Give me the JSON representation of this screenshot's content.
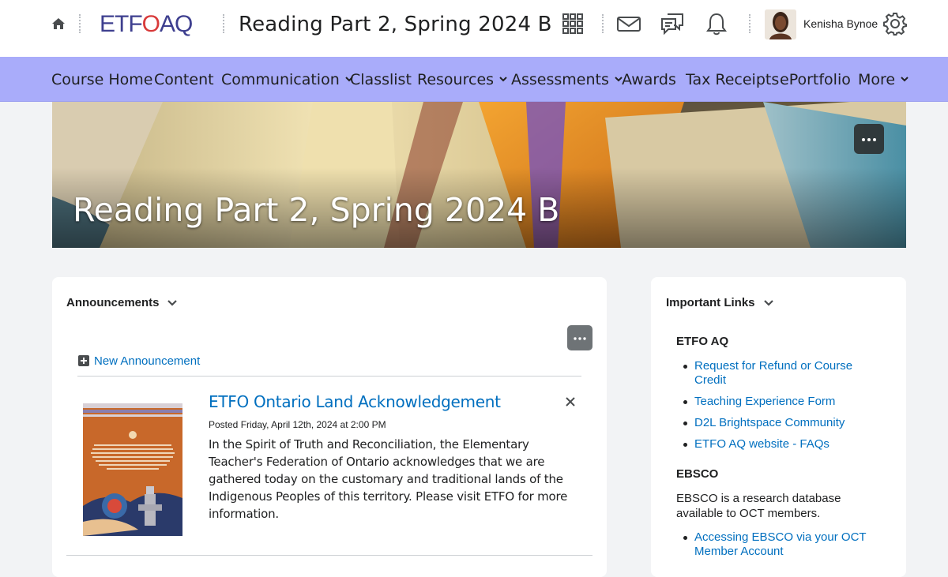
{
  "header": {
    "logo_text_left": "ETF",
    "logo_text_mid": "O",
    "logo_text_right": "AQ",
    "course_title": "Reading Part 2, Spring 2024 B",
    "user_name": "Kenisha Bynoe"
  },
  "nav": {
    "items": [
      {
        "label": "Course Home",
        "dropdown": false
      },
      {
        "label": "Content",
        "dropdown": false
      },
      {
        "label": "Communication",
        "dropdown": true
      },
      {
        "label": "Classlist",
        "dropdown": false
      },
      {
        "label": "Resources",
        "dropdown": true
      },
      {
        "label": "Assessments",
        "dropdown": true
      },
      {
        "label": "Awards",
        "dropdown": false
      },
      {
        "label": "Tax Receipts",
        "dropdown": false
      },
      {
        "label": "ePortfolio",
        "dropdown": false
      },
      {
        "label": "More",
        "dropdown": true
      }
    ]
  },
  "banner": {
    "title": "Reading Part 2, Spring 2024 B"
  },
  "announcements": {
    "title": "Announcements",
    "new_label": "New Announcement",
    "item": {
      "title": "ETFO Ontario Land Acknowledgement",
      "posted": "Posted Friday, April 12th, 2024 at 2:00 PM",
      "body": "In the Spirit of Truth and Reconciliation, the Elementary Teacher's Federation of Ontario acknowledges that we are gathered today on the customary and traditional lands of the Indigenous Peoples of this territory. Please visit ETFO for more information."
    }
  },
  "important_links": {
    "title": "Important Links",
    "etfo_heading": "ETFO AQ",
    "etfo_links": [
      "Request for Refund or Course Credit",
      "Teaching Experience Form",
      "D2L Brightspace Community",
      "ETFO AQ website - FAQs"
    ],
    "ebsco_heading": "EBSCO",
    "ebsco_desc": "EBSCO is a research database available to OCT members.",
    "ebsco_links": [
      "Accessing EBSCO via your OCT Member Account"
    ]
  },
  "colors": {
    "nav_bg": "#a9acfa",
    "link": "#006fbf",
    "logo_blue": "#3e3f8f",
    "logo_red": "#d83a3a"
  }
}
